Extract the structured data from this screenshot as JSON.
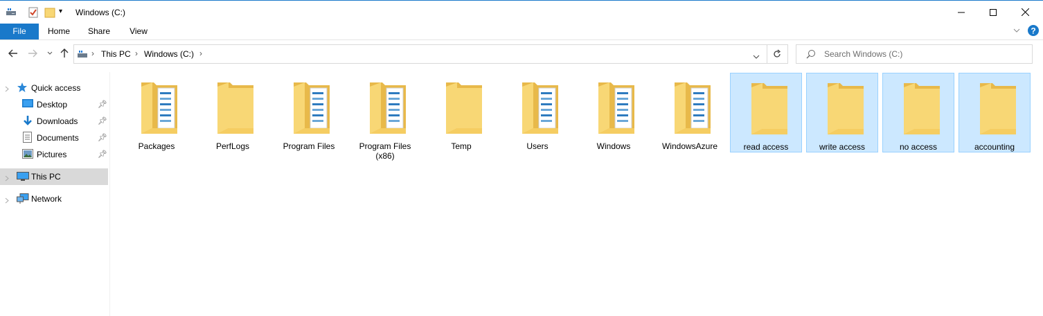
{
  "window": {
    "title": "Windows (C:)"
  },
  "ribbon": {
    "tabs": [
      "File",
      "Home",
      "Share",
      "View"
    ]
  },
  "address": {
    "crumbs": [
      "This PC",
      "Windows (C:)"
    ]
  },
  "search": {
    "placeholder": "Search Windows (C:)"
  },
  "nav": {
    "quick_access": "Quick access",
    "desktop": "Desktop",
    "downloads": "Downloads",
    "documents": "Documents",
    "pictures": "Pictures",
    "this_pc": "This PC",
    "network": "Network"
  },
  "folders": [
    {
      "name": "Packages",
      "selected": false,
      "docs": true
    },
    {
      "name": "PerfLogs",
      "selected": false,
      "docs": false
    },
    {
      "name": "Program Files",
      "selected": false,
      "docs": true
    },
    {
      "name": "Program Files (x86)",
      "selected": false,
      "docs": true
    },
    {
      "name": "Temp",
      "selected": false,
      "docs": false
    },
    {
      "name": "Users",
      "selected": false,
      "docs": true
    },
    {
      "name": "Windows",
      "selected": false,
      "docs": true
    },
    {
      "name": "WindowsAzure",
      "selected": false,
      "docs": true
    },
    {
      "name": "read access",
      "selected": true,
      "docs": false
    },
    {
      "name": "write access",
      "selected": true,
      "docs": false
    },
    {
      "name": "no access",
      "selected": true,
      "docs": false
    },
    {
      "name": "accounting",
      "selected": true,
      "docs": false
    }
  ],
  "colors": {
    "accent": "#1979ca",
    "selection": "#cce8ff",
    "folder": "#f8d775",
    "folder_back": "#e8b94a"
  }
}
